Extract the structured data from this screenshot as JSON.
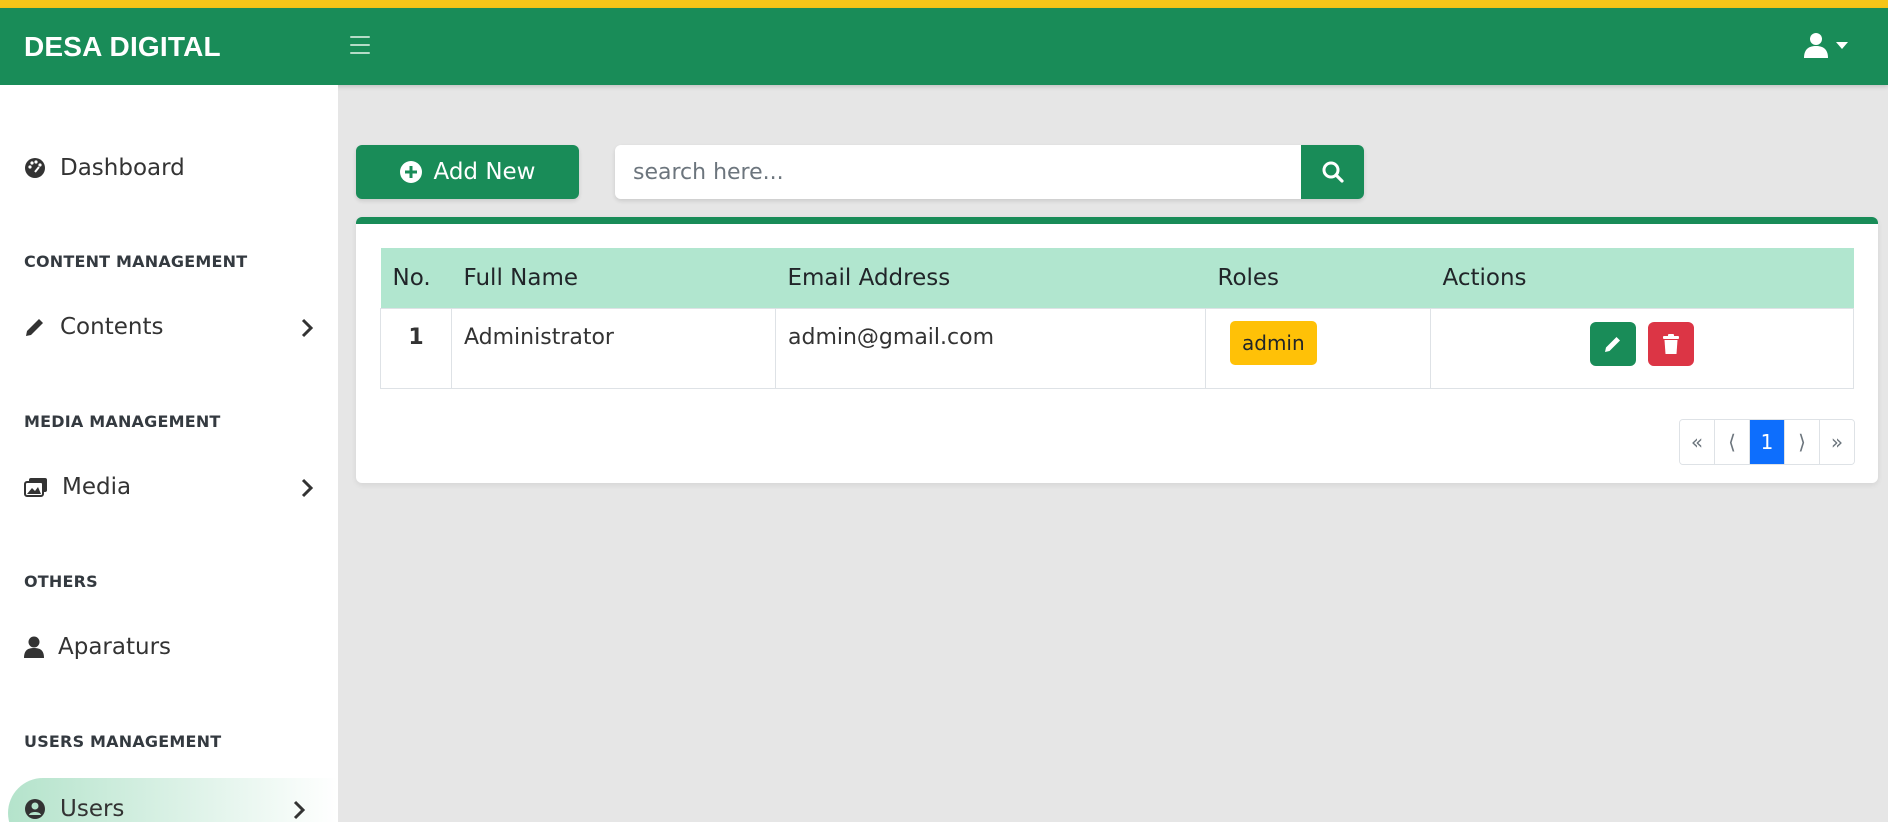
{
  "app": {
    "brand": "DESA DIGITAL"
  },
  "sidebar": {
    "dashboard": "Dashboard",
    "sections": [
      {
        "header": "CONTENT MANAGEMENT",
        "item": "Contents"
      },
      {
        "header": "MEDIA MANAGEMENT",
        "item": "Media"
      },
      {
        "header": "OTHERS",
        "item": "Aparaturs"
      },
      {
        "header": "USERS MANAGEMENT",
        "item": "Users"
      }
    ]
  },
  "toolbar": {
    "add_label": "Add New",
    "search_placeholder": "search here..."
  },
  "table": {
    "headers": [
      "No.",
      "Full Name",
      "Email Address",
      "Roles",
      "Actions"
    ],
    "rows": [
      {
        "no": "1",
        "name": "Administrator",
        "email": "admin@gmail.com",
        "role": "admin"
      }
    ]
  },
  "pagination": {
    "first": "«",
    "prev": "⟨",
    "current": "1",
    "next": "⟩",
    "last": "»"
  },
  "colors": {
    "primary": "#198c58",
    "accent_stripe": "#f5c518",
    "header_row": "#b1e6cf",
    "badge": "#ffc107",
    "danger": "#dc3545",
    "page_active": "#0d6efd"
  }
}
